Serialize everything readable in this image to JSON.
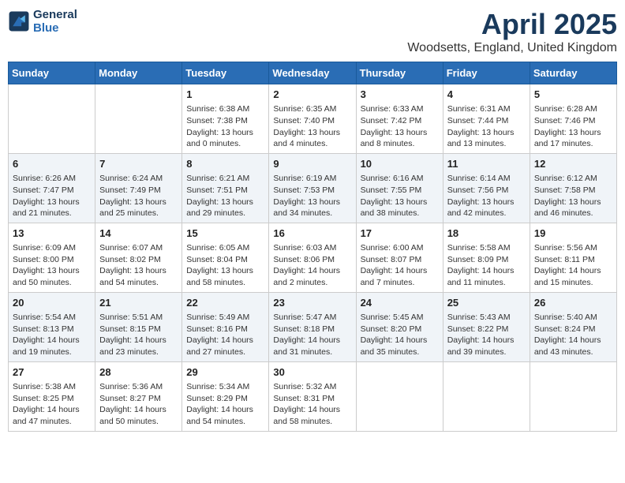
{
  "header": {
    "logo_line1": "General",
    "logo_line2": "Blue",
    "month_year": "April 2025",
    "location": "Woodsetts, England, United Kingdom"
  },
  "weekdays": [
    "Sunday",
    "Monday",
    "Tuesday",
    "Wednesday",
    "Thursday",
    "Friday",
    "Saturday"
  ],
  "weeks": [
    [
      {
        "day": "",
        "info": ""
      },
      {
        "day": "",
        "info": ""
      },
      {
        "day": "1",
        "info": "Sunrise: 6:38 AM\nSunset: 7:38 PM\nDaylight: 13 hours and 0 minutes."
      },
      {
        "day": "2",
        "info": "Sunrise: 6:35 AM\nSunset: 7:40 PM\nDaylight: 13 hours and 4 minutes."
      },
      {
        "day": "3",
        "info": "Sunrise: 6:33 AM\nSunset: 7:42 PM\nDaylight: 13 hours and 8 minutes."
      },
      {
        "day": "4",
        "info": "Sunrise: 6:31 AM\nSunset: 7:44 PM\nDaylight: 13 hours and 13 minutes."
      },
      {
        "day": "5",
        "info": "Sunrise: 6:28 AM\nSunset: 7:46 PM\nDaylight: 13 hours and 17 minutes."
      }
    ],
    [
      {
        "day": "6",
        "info": "Sunrise: 6:26 AM\nSunset: 7:47 PM\nDaylight: 13 hours and 21 minutes."
      },
      {
        "day": "7",
        "info": "Sunrise: 6:24 AM\nSunset: 7:49 PM\nDaylight: 13 hours and 25 minutes."
      },
      {
        "day": "8",
        "info": "Sunrise: 6:21 AM\nSunset: 7:51 PM\nDaylight: 13 hours and 29 minutes."
      },
      {
        "day": "9",
        "info": "Sunrise: 6:19 AM\nSunset: 7:53 PM\nDaylight: 13 hours and 34 minutes."
      },
      {
        "day": "10",
        "info": "Sunrise: 6:16 AM\nSunset: 7:55 PM\nDaylight: 13 hours and 38 minutes."
      },
      {
        "day": "11",
        "info": "Sunrise: 6:14 AM\nSunset: 7:56 PM\nDaylight: 13 hours and 42 minutes."
      },
      {
        "day": "12",
        "info": "Sunrise: 6:12 AM\nSunset: 7:58 PM\nDaylight: 13 hours and 46 minutes."
      }
    ],
    [
      {
        "day": "13",
        "info": "Sunrise: 6:09 AM\nSunset: 8:00 PM\nDaylight: 13 hours and 50 minutes."
      },
      {
        "day": "14",
        "info": "Sunrise: 6:07 AM\nSunset: 8:02 PM\nDaylight: 13 hours and 54 minutes."
      },
      {
        "day": "15",
        "info": "Sunrise: 6:05 AM\nSunset: 8:04 PM\nDaylight: 13 hours and 58 minutes."
      },
      {
        "day": "16",
        "info": "Sunrise: 6:03 AM\nSunset: 8:06 PM\nDaylight: 14 hours and 2 minutes."
      },
      {
        "day": "17",
        "info": "Sunrise: 6:00 AM\nSunset: 8:07 PM\nDaylight: 14 hours and 7 minutes."
      },
      {
        "day": "18",
        "info": "Sunrise: 5:58 AM\nSunset: 8:09 PM\nDaylight: 14 hours and 11 minutes."
      },
      {
        "day": "19",
        "info": "Sunrise: 5:56 AM\nSunset: 8:11 PM\nDaylight: 14 hours and 15 minutes."
      }
    ],
    [
      {
        "day": "20",
        "info": "Sunrise: 5:54 AM\nSunset: 8:13 PM\nDaylight: 14 hours and 19 minutes."
      },
      {
        "day": "21",
        "info": "Sunrise: 5:51 AM\nSunset: 8:15 PM\nDaylight: 14 hours and 23 minutes."
      },
      {
        "day": "22",
        "info": "Sunrise: 5:49 AM\nSunset: 8:16 PM\nDaylight: 14 hours and 27 minutes."
      },
      {
        "day": "23",
        "info": "Sunrise: 5:47 AM\nSunset: 8:18 PM\nDaylight: 14 hours and 31 minutes."
      },
      {
        "day": "24",
        "info": "Sunrise: 5:45 AM\nSunset: 8:20 PM\nDaylight: 14 hours and 35 minutes."
      },
      {
        "day": "25",
        "info": "Sunrise: 5:43 AM\nSunset: 8:22 PM\nDaylight: 14 hours and 39 minutes."
      },
      {
        "day": "26",
        "info": "Sunrise: 5:40 AM\nSunset: 8:24 PM\nDaylight: 14 hours and 43 minutes."
      }
    ],
    [
      {
        "day": "27",
        "info": "Sunrise: 5:38 AM\nSunset: 8:25 PM\nDaylight: 14 hours and 47 minutes."
      },
      {
        "day": "28",
        "info": "Sunrise: 5:36 AM\nSunset: 8:27 PM\nDaylight: 14 hours and 50 minutes."
      },
      {
        "day": "29",
        "info": "Sunrise: 5:34 AM\nSunset: 8:29 PM\nDaylight: 14 hours and 54 minutes."
      },
      {
        "day": "30",
        "info": "Sunrise: 5:32 AM\nSunset: 8:31 PM\nDaylight: 14 hours and 58 minutes."
      },
      {
        "day": "",
        "info": ""
      },
      {
        "day": "",
        "info": ""
      },
      {
        "day": "",
        "info": ""
      }
    ]
  ]
}
